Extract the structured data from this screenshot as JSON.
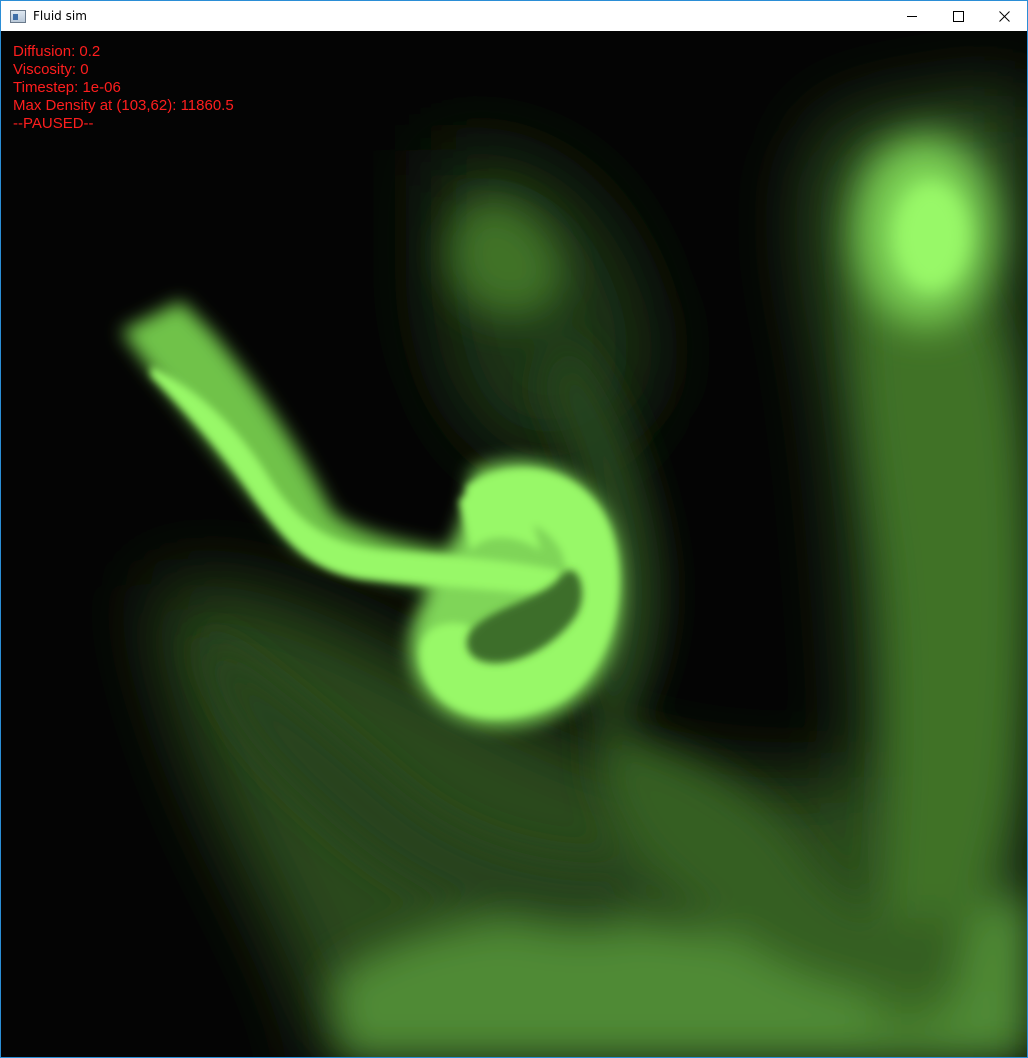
{
  "window": {
    "title": "Fluid sim",
    "icon": "app-window-icon",
    "controls": [
      {
        "name": "minimize",
        "icon": "minimize-icon"
      },
      {
        "name": "maximize",
        "icon": "maximize-icon"
      },
      {
        "name": "close",
        "icon": "close-icon"
      }
    ]
  },
  "overlay": {
    "diffusion": "Diffusion: 0.2",
    "viscosity": "Viscosity: 0",
    "timestep": "Timestep: 1e-06",
    "max_density": "Max Density at (103,62): 11860.5",
    "status": "--PAUSED--"
  },
  "colors": {
    "overlay_text": "#ff1e1e",
    "fluid_bright": "#98f868",
    "fluid_mid": "#5e9e3e",
    "fluid_dark": "#2a4a1c",
    "background": "#040404",
    "window_border": "#2b8ed6"
  }
}
